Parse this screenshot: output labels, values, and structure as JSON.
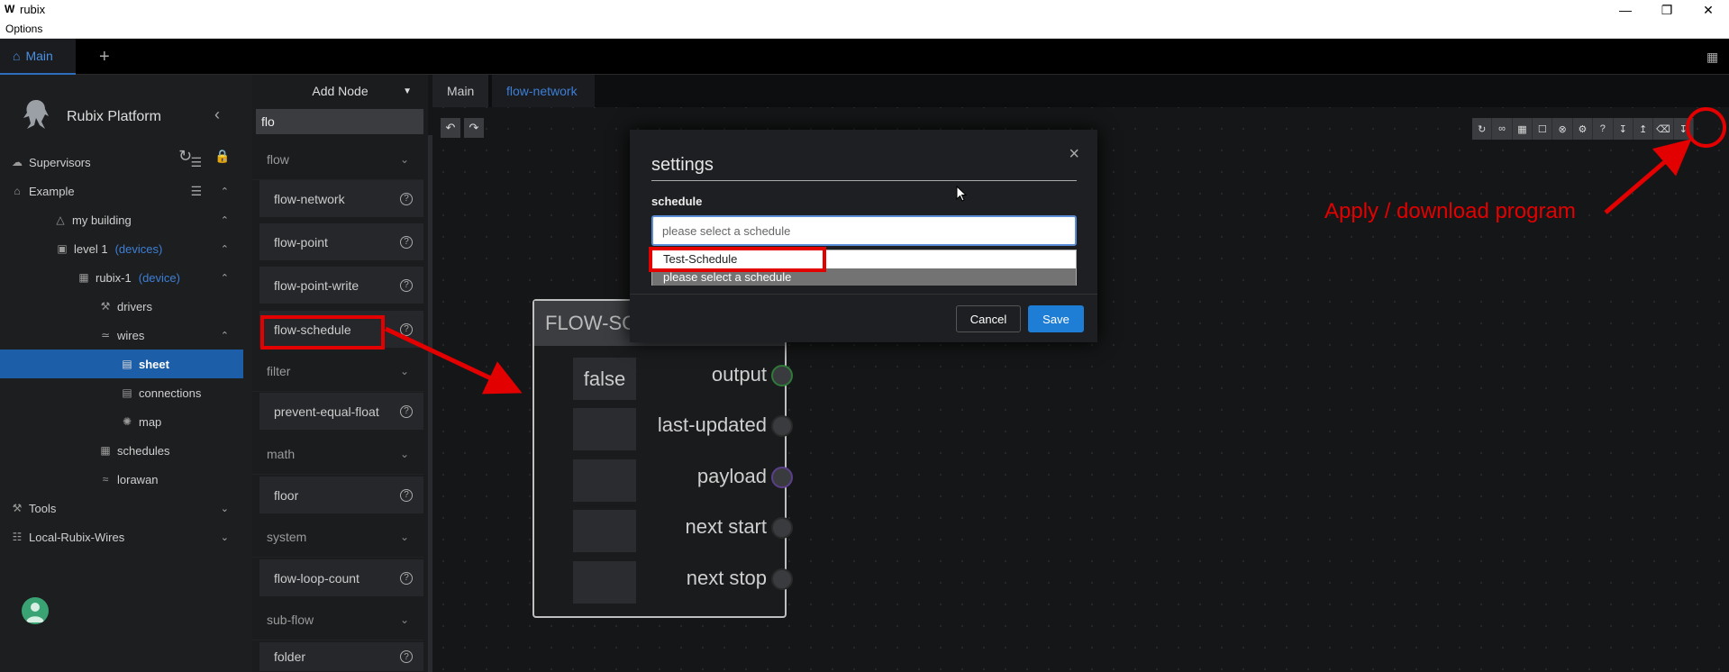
{
  "window": {
    "title": "rubix",
    "logo_letter": "W",
    "menu": "Options"
  },
  "top_tabs": {
    "main_label": "Main",
    "add_label": "+"
  },
  "sidebar": {
    "brand": "Rubix Platform",
    "items": [
      {
        "label": "Supervisors"
      },
      {
        "label": "Example"
      },
      {
        "label": "my building"
      },
      {
        "label": "level 1",
        "tag": "(devices)"
      },
      {
        "label": "rubix-1",
        "tag": "(device)"
      },
      {
        "label": "drivers"
      },
      {
        "label": "wires"
      },
      {
        "label": "sheet"
      },
      {
        "label": "connections"
      },
      {
        "label": "map"
      },
      {
        "label": "schedules"
      },
      {
        "label": "lorawan"
      },
      {
        "label": "Tools"
      },
      {
        "label": "Local-Rubix-Wires"
      }
    ]
  },
  "palette": {
    "title": "Add Node",
    "search_value": "flo",
    "categories": [
      "flow",
      "filter",
      "math",
      "system",
      "sub-flow"
    ],
    "items": [
      "flow-network",
      "flow-point",
      "flow-point-write",
      "flow-schedule",
      "prevent-equal-float",
      "floor",
      "flow-loop-count",
      "folder"
    ]
  },
  "editor": {
    "tabs": [
      "Main",
      "flow-network"
    ]
  },
  "node": {
    "title": "FLOW-SC",
    "input_value": "false",
    "outputs": [
      "output",
      "last-updated",
      "payload",
      "next start",
      "next stop"
    ]
  },
  "modal": {
    "title": "settings",
    "field_label": "schedule",
    "select_value": "please select a schedule",
    "options": [
      "Test-Schedule",
      "please select a schedule"
    ],
    "cancel_label": "Cancel",
    "save_label": "Save",
    "close_glyph": "×"
  },
  "annotation": {
    "text": "Apply / download program",
    "color": "#e30000"
  },
  "colors": {
    "accent": "#1e7ed6",
    "selected": "#1d5ea8",
    "annotation": "#e30000"
  }
}
